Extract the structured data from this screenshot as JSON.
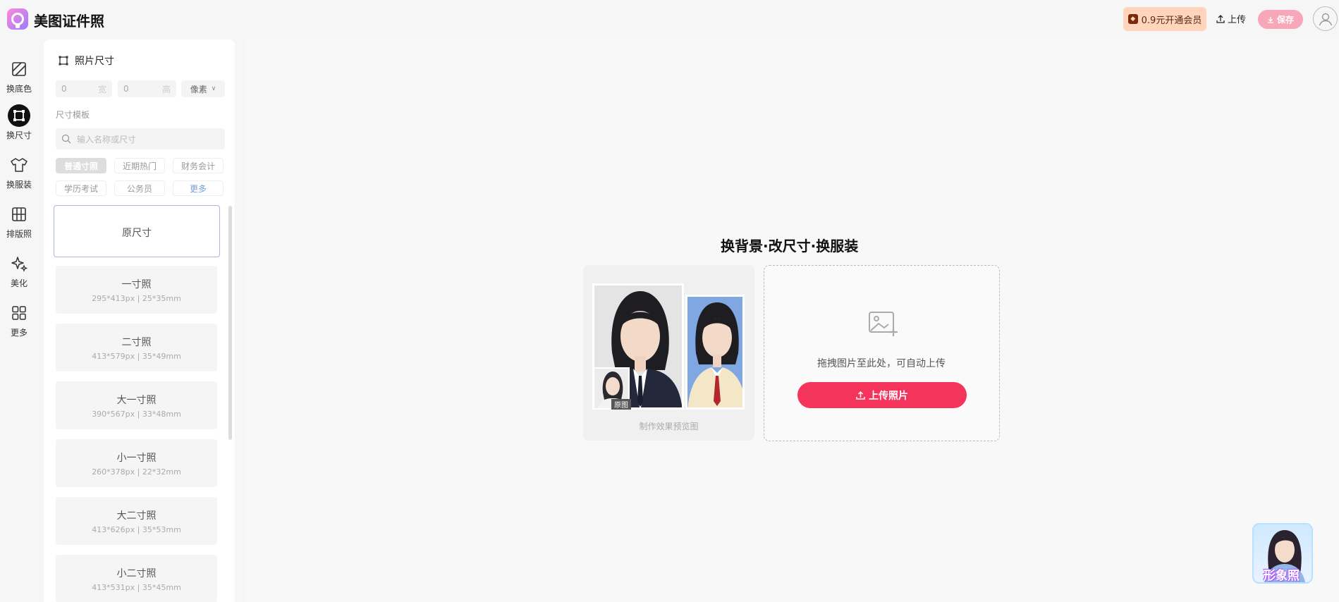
{
  "app": {
    "title": "美图证件照"
  },
  "header": {
    "vip_label": "0.9元开通会员",
    "upload_label": "上传",
    "save_label": "保存"
  },
  "rail": {
    "items": [
      {
        "label": "换底色",
        "icon": "background-color-icon"
      },
      {
        "label": "换尺寸",
        "icon": "resize-icon",
        "active": true
      },
      {
        "label": "换服装",
        "icon": "shirt-icon"
      },
      {
        "label": "排版照",
        "icon": "grid-layout-icon"
      },
      {
        "label": "美化",
        "icon": "sparkle-icon"
      },
      {
        "label": "更多",
        "icon": "apps-icon"
      }
    ]
  },
  "panel": {
    "title": "照片尺寸",
    "width_value": "0",
    "width_suffix": "宽",
    "height_value": "0",
    "height_suffix": "高",
    "unit": "像素",
    "template_label": "尺寸模板",
    "search_placeholder": "输入名称或尺寸",
    "categories": [
      "普通寸照",
      "近期热门",
      "财务会计",
      "学历考试",
      "公务员",
      "更多"
    ],
    "sizes": [
      {
        "name": "原尺寸",
        "spec": ""
      },
      {
        "name": "一寸照",
        "spec": "295*413px | 25*35mm"
      },
      {
        "name": "二寸照",
        "spec": "413*579px | 35*49mm"
      },
      {
        "name": "大一寸照",
        "spec": "390*567px | 33*48mm"
      },
      {
        "name": "小一寸照",
        "spec": "260*378px | 22*32mm"
      },
      {
        "name": "大二寸照",
        "spec": "413*626px | 35*53mm"
      },
      {
        "name": "小二寸照",
        "spec": "413*531px | 35*45mm"
      }
    ]
  },
  "main": {
    "hero_title": "换背景·改尺寸·换服装",
    "preview_caption": "制作效果预览图",
    "original_tag": "原图",
    "drop_text": "拖拽图片至此处，可自动上传",
    "upload_button": "上传照片",
    "badge_text": "形象照"
  },
  "colors": {
    "accent": "#f4345b",
    "vip_bg": "#ffd6bd",
    "save_bg": "#f7a7b8",
    "photo_blue": "#7fa8e2"
  }
}
